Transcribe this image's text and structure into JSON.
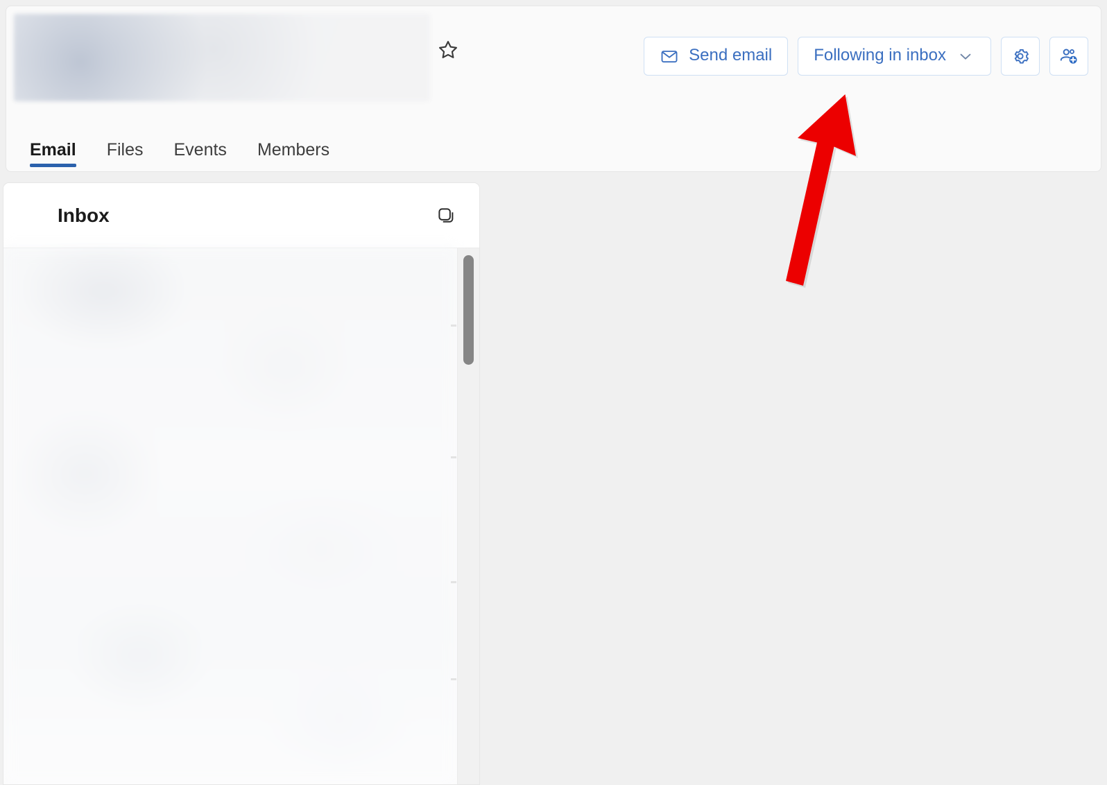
{
  "header": {
    "group_title_redacted": "",
    "star_icon": "star-icon",
    "actions": [
      {
        "id": "send-email",
        "label": "Send email",
        "icon": "mail-icon",
        "type": "text"
      },
      {
        "id": "following-in-inbox",
        "label": "Following in inbox",
        "icon": "chevron-down-icon",
        "type": "dropdown"
      },
      {
        "id": "group-settings",
        "label": "",
        "icon": "gear-icon",
        "type": "icon"
      },
      {
        "id": "add-members",
        "label": "",
        "icon": "person-add-icon",
        "type": "icon"
      }
    ],
    "tabs": [
      {
        "label": "Email",
        "active": true
      },
      {
        "label": "Files",
        "active": false
      },
      {
        "label": "Events",
        "active": false
      },
      {
        "label": "Members",
        "active": false
      }
    ]
  },
  "list_panel": {
    "title": "Inbox",
    "stack_icon": "conversation-stack-icon",
    "messages_redacted": ""
  },
  "reading_pane": {
    "content": ""
  },
  "annotation": {
    "type": "arrow",
    "direction": "up",
    "color": "#ec0000",
    "points_to": "following-in-inbox"
  },
  "colors": {
    "accent_blue": "#2b61ac",
    "link_blue": "#3b6fc0",
    "button_border": "#cfe0f4",
    "header_bg": "#fafafa",
    "pane_bg": "#f0f0f0",
    "card_border": "#e6e6e6",
    "scroll_thumb": "#868686",
    "annotation_red": "#ec0000"
  }
}
